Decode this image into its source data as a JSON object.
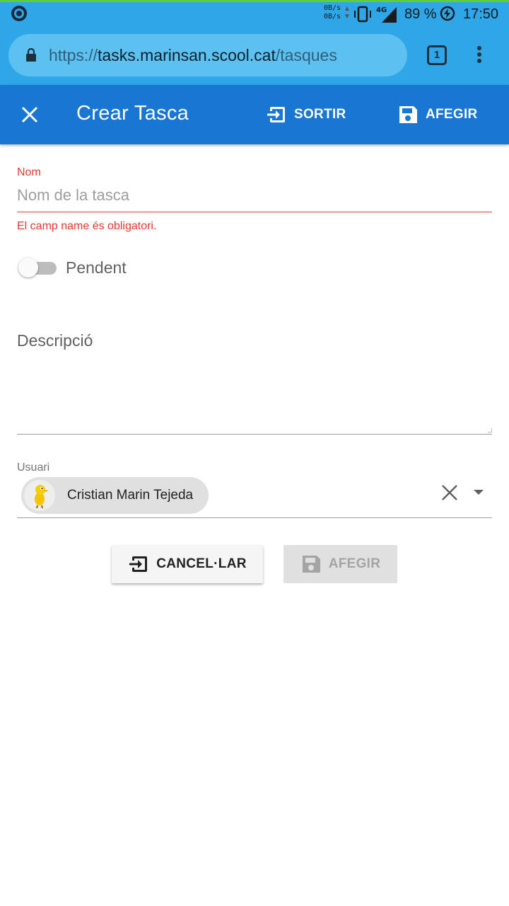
{
  "status_bar": {
    "net_up": "0B/s",
    "net_down": "0B/s",
    "network": "4G",
    "battery": "89 %",
    "time": "17:50"
  },
  "browser": {
    "url_scheme": "https://",
    "url_host": "tasks.marinsan.scool.cat",
    "url_path": "/tasques",
    "tab_count": "1"
  },
  "toolbar": {
    "title": "Crear Tasca",
    "exit_label": "SORTIR",
    "add_label": "AFEGIR"
  },
  "form": {
    "name": {
      "label": "Nom",
      "placeholder": "Nom de la tasca",
      "value": "",
      "error": "El camp name és obligatori."
    },
    "completed": {
      "label": "Pendent",
      "checked": false
    },
    "description": {
      "label": "Descripció",
      "value": ""
    },
    "user": {
      "label": "Usuari",
      "selected": "Cristian Marin Tejeda"
    },
    "cancel_label": "CANCEL·LAR",
    "submit_label": "AFEGIR"
  },
  "colors": {
    "status_bar": "#2ea6e8",
    "toolbar": "#1976d2",
    "error": "#e53935"
  }
}
